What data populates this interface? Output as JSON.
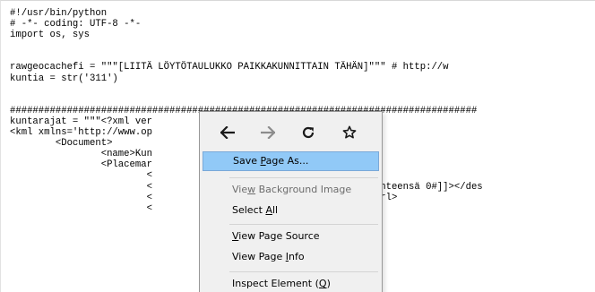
{
  "code_lines": [
    "#!/usr/bin/python",
    "# -*- coding: UTF-8 -*-",
    "import os, sys",
    "",
    "",
    "rawgeocachefi = \"\"\"[LIITÄ LÖYTÖTAULUKKO PAIKKAKUNNITTAIN TÄHÄN]\"\"\" # http://w",
    "kuntia = str('311')",
    "",
    "",
    "##################################################################################",
    "kuntarajat = \"\"\"<?xml ver                              -8'?>",
    "<kml xmlns='http://www.op",
    "        <Document>",
    "                <name>Kun",
    "                <Placemar",
    "                        <",
    "                        <                              usiainen yhteensä 0#]]></des",
    "                        <                              64</styleUrl>",
    "                        <"
  ],
  "context_menu": {
    "nav": {
      "back_icon": "arrow-left-icon",
      "forward_icon": "arrow-right-icon",
      "reload_icon": "reload-icon",
      "bookmark_icon": "star-icon"
    },
    "items": [
      {
        "pre": "Save ",
        "key": "P",
        "post": "age As..."
      },
      {
        "pre": "Vie",
        "key": "w",
        "post": " Background Image"
      },
      {
        "pre": "Select ",
        "key": "A",
        "post": "ll"
      },
      {
        "pre": "",
        "key": "V",
        "post": "iew Page Source"
      },
      {
        "pre": "View Page ",
        "key": "I",
        "post": "nfo"
      },
      {
        "pre": "Inspect Element (",
        "key": "Q",
        "post": ")"
      }
    ]
  },
  "colors": {
    "menu_bg": "#f0f0f0",
    "highlight": "#91c9f7",
    "disabled_text": "#6d6d6d",
    "forward_disabled": "#8c8c8c"
  }
}
